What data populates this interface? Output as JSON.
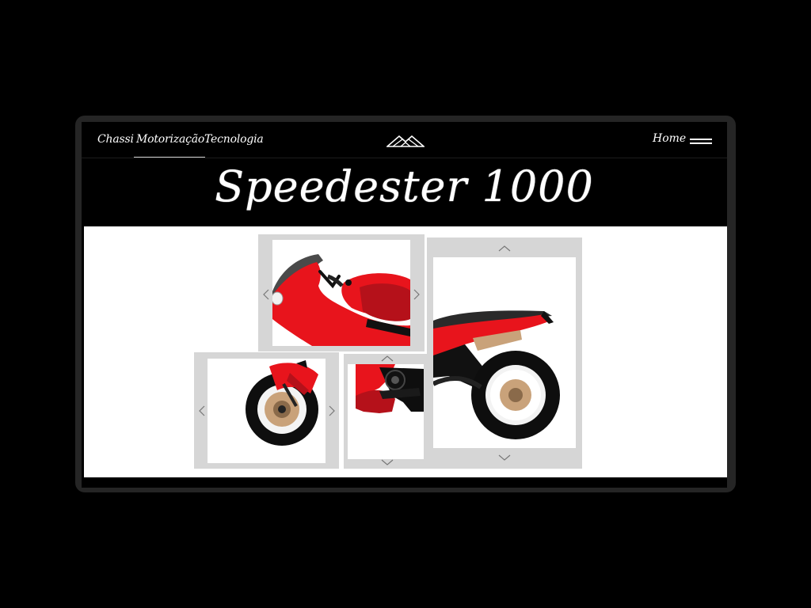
{
  "nav": {
    "links": [
      {
        "label": "Chassi",
        "active": false
      },
      {
        "label": "Motorização",
        "active": true
      },
      {
        "label": "Tecnologia",
        "active": false
      }
    ],
    "home_label": "Home",
    "logo_icon": "mountain-logo-icon",
    "menu_icon": "hamburger-icon"
  },
  "hero": {
    "title": "Speedester 1000"
  },
  "puzzle": {
    "tiles": [
      {
        "name": "tile-front-body",
        "arrows": [
          "left",
          "right"
        ]
      },
      {
        "name": "tile-rear-section",
        "arrows": [
          "up",
          "down"
        ]
      },
      {
        "name": "tile-front-wheel",
        "arrows": [
          "left",
          "right"
        ]
      },
      {
        "name": "tile-engine",
        "arrows": [
          "up",
          "down"
        ]
      }
    ],
    "colors": {
      "frame": "#d6d6d6",
      "bike_red": "#e8141c",
      "dark_red": "#b5111a",
      "wheel": "#0e0e0e",
      "rim": "#c9a27a"
    }
  }
}
